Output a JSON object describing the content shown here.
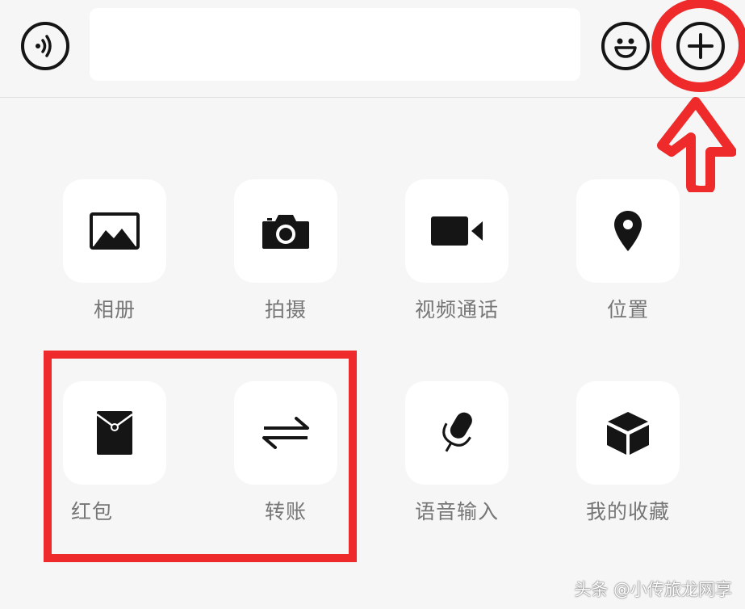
{
  "input_bar": {
    "voice_button_icon": "voice-icon",
    "text_value": "",
    "emoji_button_icon": "smiley-icon",
    "plus_button_icon": "plus-icon"
  },
  "panel": {
    "items": [
      {
        "label": "相册",
        "icon": "picture-icon"
      },
      {
        "label": "拍摄",
        "icon": "camera-icon"
      },
      {
        "label": "视频通话",
        "icon": "video-camera-icon"
      },
      {
        "label": "位置",
        "icon": "location-pin-icon"
      },
      {
        "label": "红包",
        "icon": "red-packet-icon"
      },
      {
        "label": "转账",
        "icon": "transfer-arrows-icon"
      },
      {
        "label": "语音输入",
        "icon": "microphone-icon"
      },
      {
        "label": "我的收藏",
        "icon": "cube-icon"
      }
    ]
  },
  "annotations": {
    "color": "#ee2a2a"
  },
  "watermark": {
    "text": "头条 @小传旅龙网享"
  }
}
